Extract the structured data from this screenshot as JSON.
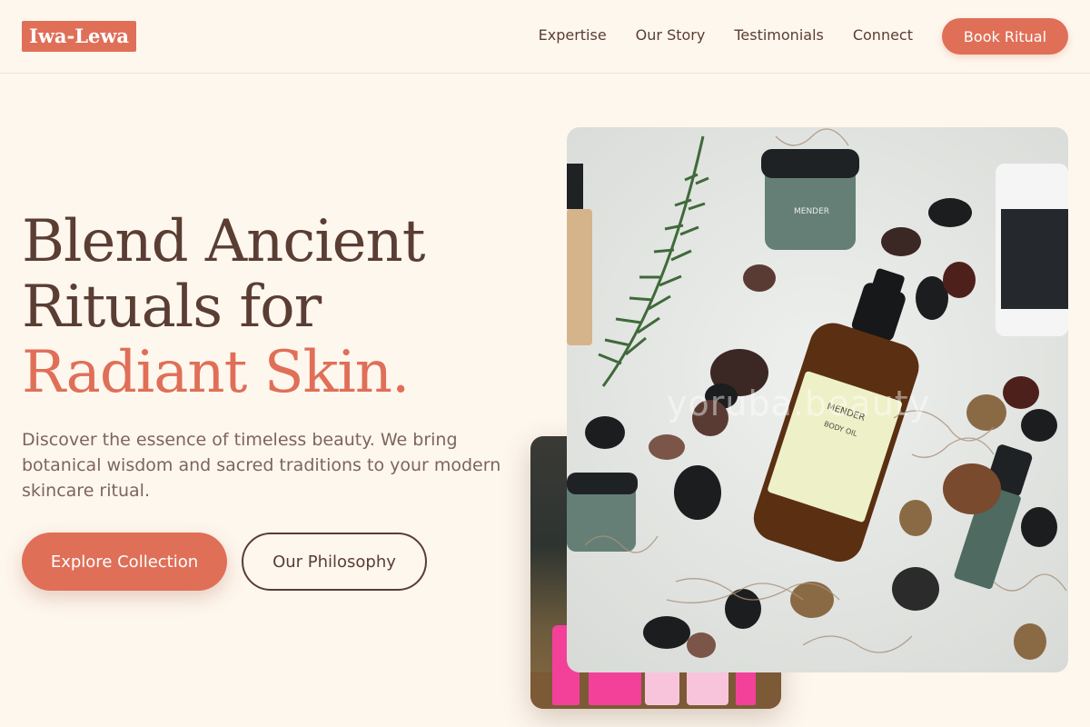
{
  "brand": {
    "name": "Iwa-Lewa"
  },
  "nav": {
    "items": [
      {
        "label": "Expertise"
      },
      {
        "label": "Our Story"
      },
      {
        "label": "Testimonials"
      },
      {
        "label": "Connect"
      }
    ],
    "cta": "Book Ritual"
  },
  "hero": {
    "headline_part1": "Blend Ancient Rituals for ",
    "headline_accent": "Radiant Skin.",
    "description": "Discover the essence of timeless beauty. We bring botanical wisdom and sacred traditions to your modern skincare ritual.",
    "primary_cta": "Explore Collection",
    "secondary_cta": "Our Philosophy"
  },
  "images": {
    "main_watermark": "yoruba.beauty",
    "bottle_label_brand": "MENDER",
    "bottle_label_product": "BODY OIL",
    "jar_label": "MENDER"
  },
  "colors": {
    "accent": "#e06f58",
    "text": "#5a3d33",
    "background": "#fef7ee"
  }
}
